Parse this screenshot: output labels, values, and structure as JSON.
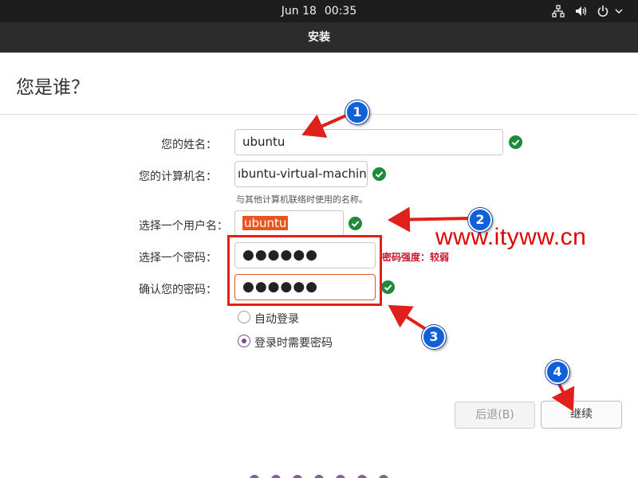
{
  "topbar": {
    "date": "Jun 18",
    "time": "00:35"
  },
  "window": {
    "title": "安装"
  },
  "page": {
    "heading": "您是谁？"
  },
  "form": {
    "name_label": "您的姓名：",
    "name_value": "ubuntu",
    "computer_label": "您的计算机名：",
    "computer_value": "ıbuntu-virtual-machine",
    "computer_hint": "与其他计算机联络时使用的名称。",
    "username_label": "选择一个用户名：",
    "username_value": "ubuntu",
    "password_label": "选择一个密码：",
    "password_value": "●●●●●●",
    "password_strength": "密码强度：较弱",
    "confirm_label": "确认您的密码：",
    "confirm_value": "●●●●●●",
    "option_auto_login": "自动登录",
    "option_require_password": "登录时需要密码",
    "selected_option": "登录时需要密码"
  },
  "buttons": {
    "back": "后退(B)",
    "continue": "继续"
  },
  "annotations": {
    "watermark": "www.ityww.cn",
    "badge_1": "1",
    "badge_2": "2",
    "badge_3": "3",
    "badge_4": "4"
  },
  "colors": {
    "accent": "#e95420",
    "ok": "#1f8a3a",
    "radio": "#7d4a8c",
    "annotation_red": "#e0201a",
    "badge_blue": "#1060d8"
  },
  "icons": [
    "network-icon",
    "volume-icon",
    "power-icon",
    "chevron-down-icon",
    "check-icon"
  ]
}
